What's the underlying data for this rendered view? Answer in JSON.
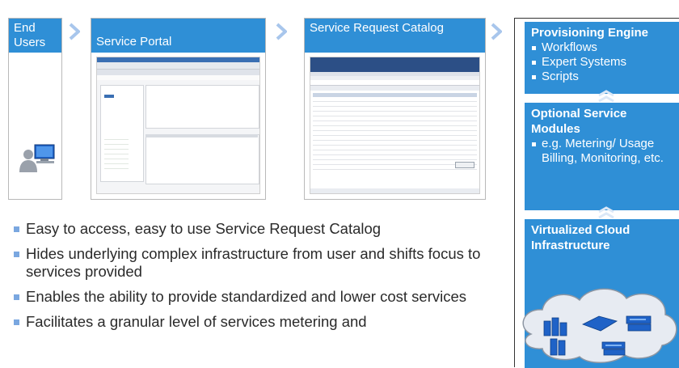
{
  "flow": {
    "end_users": "End Users",
    "service_portal": "Service Portal",
    "catalog": "Service Request Catalog"
  },
  "bullets": [
    "Easy to access, easy to use Service Request Catalog",
    "Hides underlying complex infrastructure from user and shifts focus to services provided",
    "Enables the ability to provide standardized and lower cost services",
    "Facilitates a granular level of services metering and"
  ],
  "engine": {
    "title": "Provisioning Engine",
    "items": [
      "Workflows",
      "Expert Systems",
      "Scripts"
    ]
  },
  "modules": {
    "title": "Optional Service Modules",
    "items": [
      "e.g. Metering/ Usage Billing, Monitoring, etc."
    ]
  },
  "cloud": {
    "title": "Virtualized Cloud Infrastructure"
  },
  "colors": {
    "accent": "#2f8fd6",
    "arrow": "#a8c6ec",
    "bullet": "#7aa7e0"
  }
}
